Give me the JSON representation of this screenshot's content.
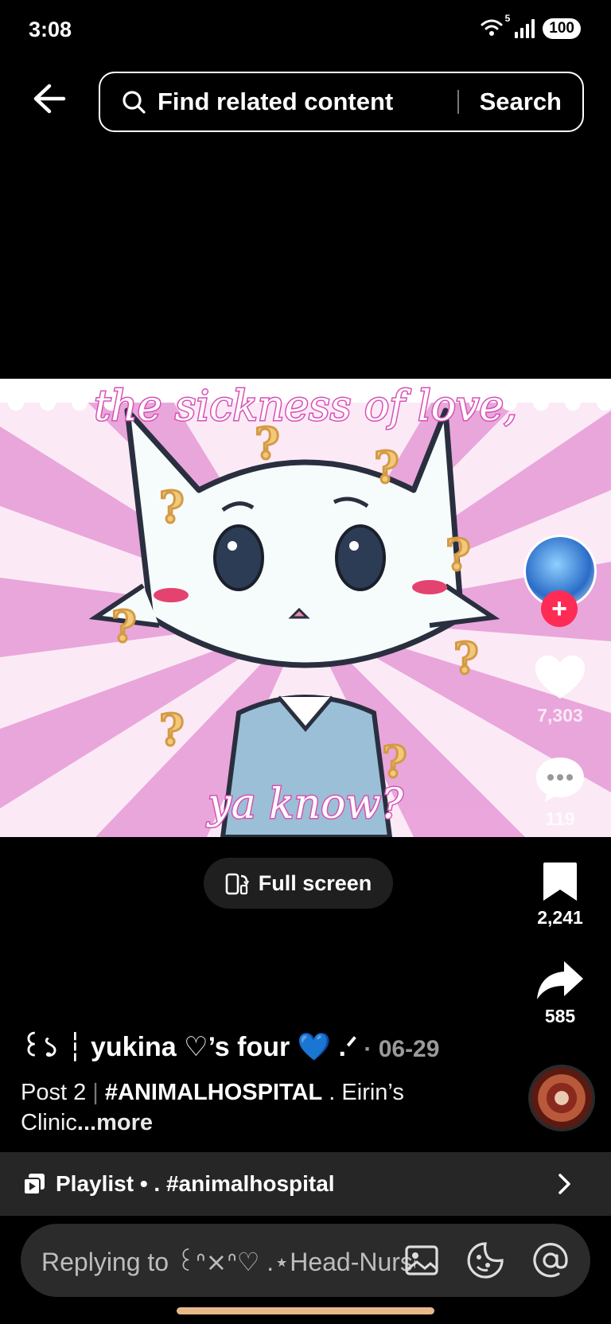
{
  "status_bar": {
    "time": "3:08",
    "wifi_superscript": "5",
    "battery": "100"
  },
  "search": {
    "placeholder": "Find related content",
    "button_label": "Search"
  },
  "video": {
    "caption_top": "the sickness of love,",
    "caption_bottom": "ya know?",
    "colors": {
      "pink": "#e37fcf",
      "bg": "#fbeaf6",
      "outline": "#2a2f3f"
    }
  },
  "rail": {
    "likes": "7,303",
    "comments": "119",
    "bookmarks": "2,241",
    "shares": "585",
    "follow_symbol": "+"
  },
  "fullscreen": {
    "label": "Full screen"
  },
  "post": {
    "author": "꒰১ ┆ yukina  ♡’s  four 💙 .ᐟ",
    "date": "· 06-29",
    "caption_prefix": "Post 2",
    "caption_sep": "|",
    "caption_tag": "#ANIMALHOSPITAL",
    "caption_text": " . Eirin’s Clinic",
    "caption_more": "...more"
  },
  "playlist": {
    "label": "Playlist • . #animalhospital"
  },
  "reply": {
    "placeholder": "Replying to ꒰ᐢ⨯ᐢ♡ .⋆Head-Nurse"
  },
  "accent_colors": {
    "follow": "#fe2c55",
    "home_indicator": "#e7b98a"
  }
}
